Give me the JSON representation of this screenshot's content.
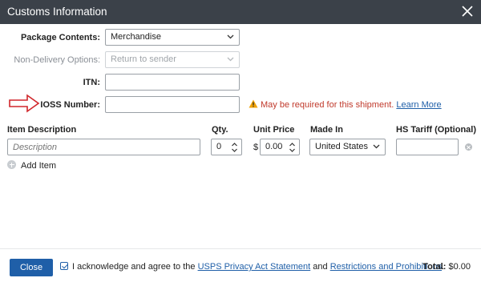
{
  "dialog": {
    "title": "Customs Information"
  },
  "form": {
    "package_contents": {
      "label": "Package Contents:",
      "value": "Merchandise"
    },
    "non_delivery": {
      "label": "Non-Delivery Options:",
      "value": "Return to sender"
    },
    "itn": {
      "label": "ITN:",
      "value": ""
    },
    "ioss": {
      "label": "IOSS Number:",
      "value": ""
    },
    "warning": {
      "text": "May be required for this shipment.",
      "link": "Learn More"
    }
  },
  "items": {
    "headers": {
      "description": "Item Description",
      "qty": "Qty.",
      "unit_price": "Unit Price",
      "made_in": "Made In",
      "hs_tariff": "HS Tariff (Optional)"
    },
    "row": {
      "description_placeholder": "Description",
      "qty": "0",
      "currency": "$",
      "unit_price": "0.00",
      "made_in": "United States",
      "hs_tariff": ""
    },
    "add_item": "Add Item"
  },
  "footer": {
    "close": "Close",
    "ack_prefix": "I acknowledge and agree to the",
    "ack_link1": "USPS Privacy Act Statement",
    "ack_and": "and",
    "ack_link2": "Restrictions and Prohibitions",
    "ack_suffix": ".",
    "total_label": "Total:",
    "total_value": "$0.00"
  },
  "colors": {
    "titlebar": "#3b4149",
    "primary": "#1f5fa8",
    "warning": "#c0392b",
    "arrow": "#d0262b"
  }
}
